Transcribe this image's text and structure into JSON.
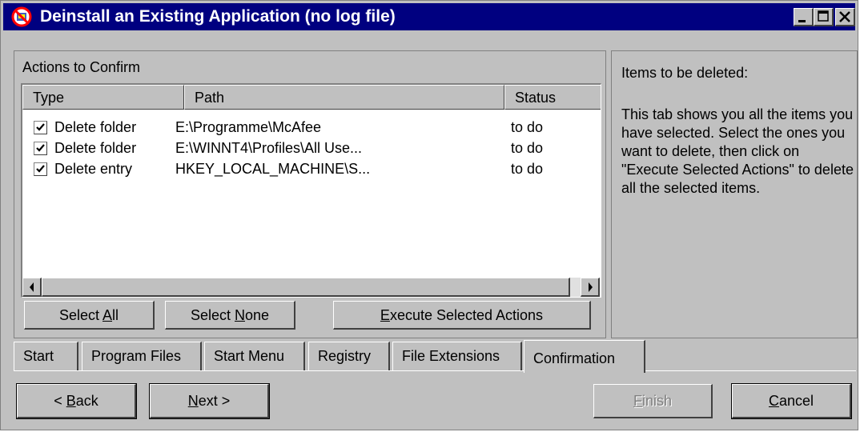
{
  "window": {
    "title": "Deinstall an Existing Application (no log file)",
    "controls": [
      "minimize-icon",
      "maximize-icon",
      "close-icon"
    ],
    "title_bar_color": "#000080"
  },
  "actions_panel": {
    "label": "Actions to Confirm",
    "columns": [
      "Type",
      "Path",
      "Status"
    ],
    "rows": [
      {
        "checked": true,
        "type": "Delete folder",
        "path": "E:\\Programme\\McAfee",
        "status": "to do"
      },
      {
        "checked": true,
        "type": "Delete folder",
        "path": "E:\\WINNT4\\Profiles\\All Use...",
        "status": "to do"
      },
      {
        "checked": true,
        "type": "Delete entry",
        "path": "HKEY_LOCAL_MACHINE\\S...",
        "status": "to do"
      }
    ],
    "select_all": {
      "pre": "Select ",
      "key": "A",
      "post": "ll"
    },
    "select_none": {
      "pre": "Select ",
      "key": "N",
      "post": "one"
    },
    "execute": {
      "pre": "",
      "key": "E",
      "post": "xecute Selected Actions"
    }
  },
  "help": {
    "title": "Items to be deleted:",
    "body": "This tab shows you all the items you have selected. Select the ones you want to delete, then click on \"Execute Selected Actions\" to delete all the selected items."
  },
  "tabs": [
    {
      "label": "Start",
      "active": false
    },
    {
      "label": "Program Files",
      "active": false
    },
    {
      "label": "Start Menu",
      "active": false
    },
    {
      "label": "Registry",
      "active": false
    },
    {
      "label": "File Extensions",
      "active": false
    },
    {
      "label": "Confirmation",
      "active": true
    }
  ],
  "nav": {
    "back": {
      "pre": "< ",
      "key": "B",
      "post": "ack"
    },
    "next": {
      "pre": "",
      "key": "N",
      "post": "ext  >"
    },
    "finish": {
      "pre": "",
      "key": "F",
      "post": "inish",
      "disabled": true
    },
    "cancel": {
      "pre": "",
      "key": "C",
      "post": "ancel"
    }
  }
}
